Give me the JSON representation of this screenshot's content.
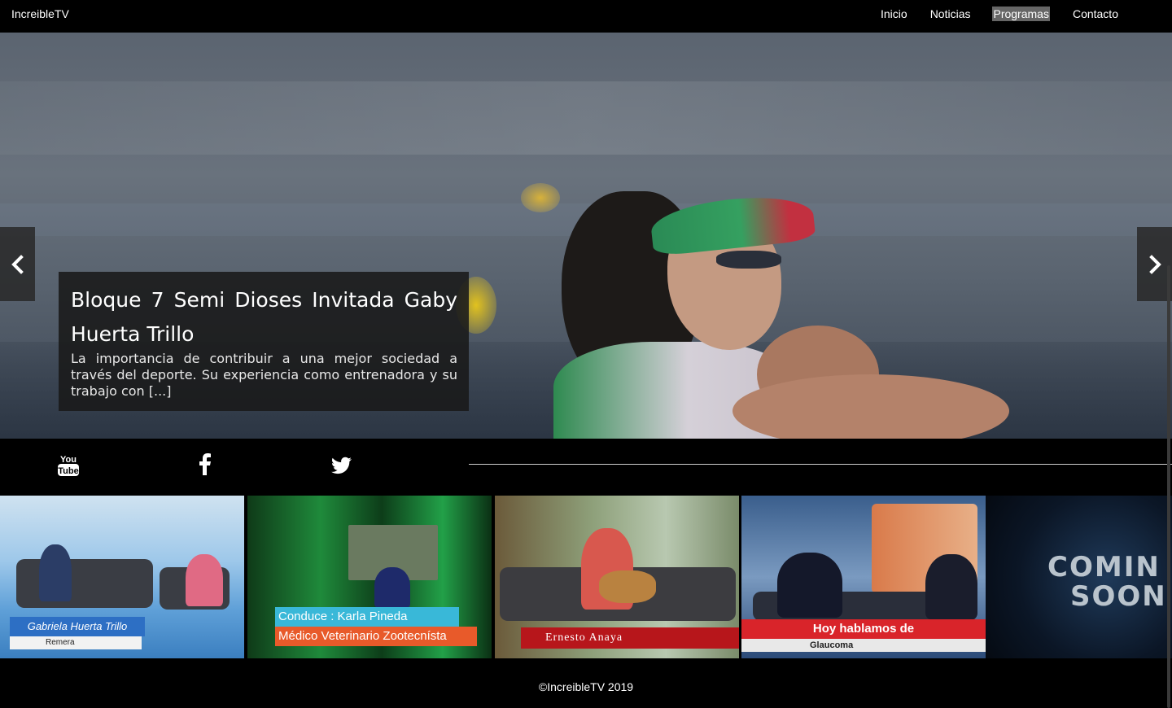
{
  "header": {
    "brand": "IncreibleTV",
    "nav": [
      {
        "label": "Inicio",
        "active": false
      },
      {
        "label": "Noticias",
        "active": false
      },
      {
        "label": "Programas",
        "active": true
      },
      {
        "label": "Contacto",
        "active": false
      }
    ]
  },
  "hero": {
    "title": "Bloque 7 Semi Dioses Invitada Gaby Huerta Trillo",
    "description": "La importancia de contribuir a una mejor sociedad a través del deporte. Su experiencia como entrenadora y su trabajo con [...]",
    "prev_icon": "chevron-left-icon",
    "next_icon": "chevron-right-icon"
  },
  "social": [
    {
      "name": "youtube-icon",
      "label": "YouTube"
    },
    {
      "name": "facebook-icon",
      "label": "Facebook"
    },
    {
      "name": "twitter-icon",
      "label": "Twitter"
    }
  ],
  "programs": [
    {
      "line1": "Gabriela Huerta Trillo",
      "line2": "Remera"
    },
    {
      "line1": "Conduce : Karla Pineda",
      "line2": "Médico Veterinario Zootecnísta"
    },
    {
      "line1": "Ernesto Anaya"
    },
    {
      "line1": "Hoy hablamos de",
      "line2": "Glaucoma"
    },
    {
      "line1": "COMIN",
      "line2": "SOON"
    }
  ],
  "footer": {
    "copyright": "©IncreibleTV 2019"
  },
  "colors": {
    "background": "#000000",
    "nav_active_bg": "#666666",
    "caption_bg": "#191919"
  }
}
